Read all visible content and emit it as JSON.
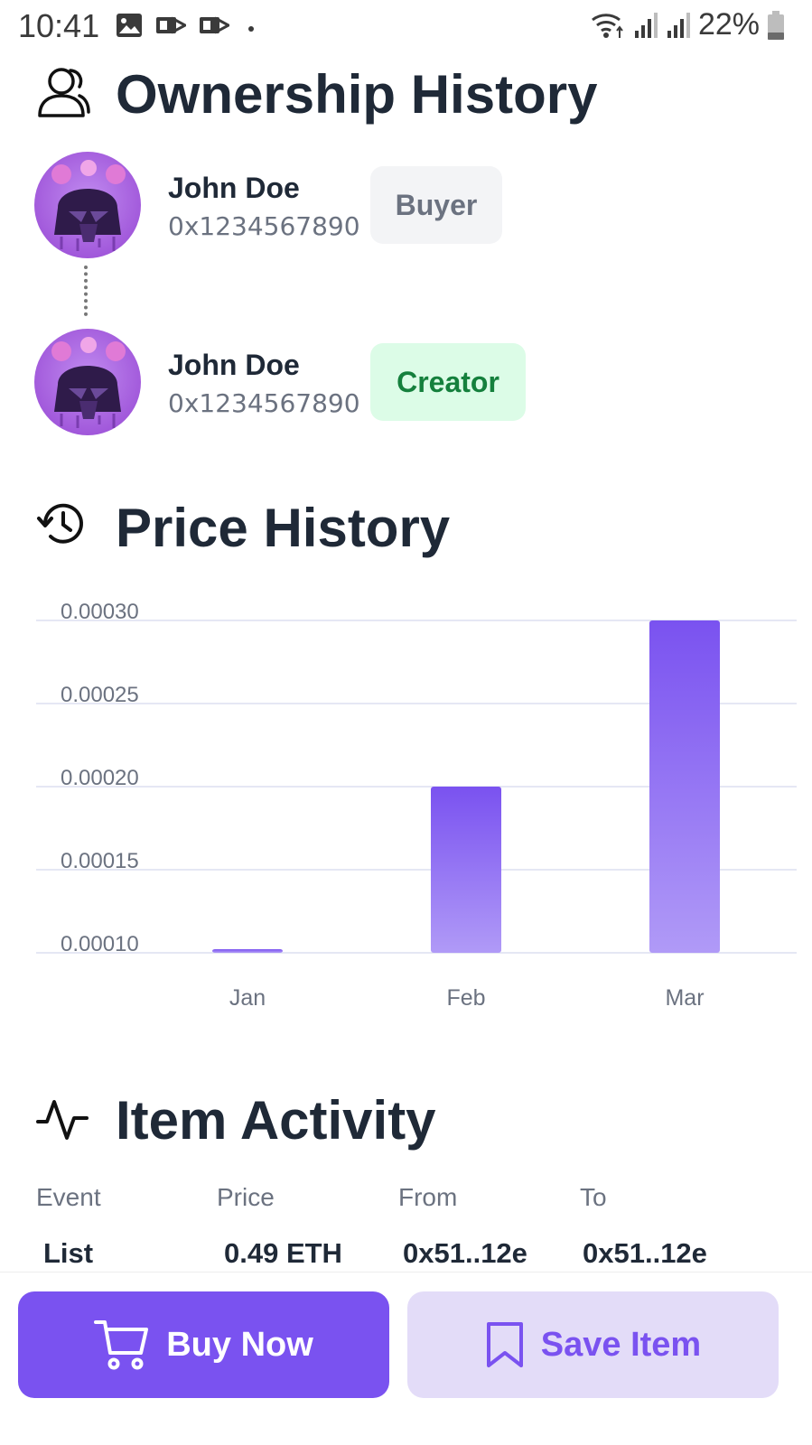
{
  "status_bar": {
    "time": "10:41",
    "battery": "22%",
    "icons_left": [
      "gallery-icon",
      "mail-icon",
      "mail-icon",
      "dot-icon"
    ],
    "icons_right": [
      "wifi-icon",
      "signal-icon",
      "signal-icon",
      "battery-icon"
    ]
  },
  "ownership": {
    "title": "Ownership History",
    "owners": [
      {
        "name": "John Doe",
        "address": "0x1234567890",
        "role": "Buyer"
      },
      {
        "name": "John Doe",
        "address": "0x1234567890",
        "role": "Creator"
      }
    ]
  },
  "price_history": {
    "title": "Price History"
  },
  "chart_data": {
    "type": "bar",
    "categories": [
      "Jan",
      "Feb",
      "Mar"
    ],
    "values": [
      0.0001,
      0.0002,
      0.0003
    ],
    "yticks": [
      "0.00010",
      "0.00015",
      "0.00020",
      "0.00025",
      "0.00030"
    ],
    "ylim": [
      0.0001,
      0.0003
    ],
    "grid": true,
    "color": "#8b66f3"
  },
  "activity": {
    "title": "Item Activity",
    "columns": [
      "Event",
      "Price",
      "From",
      "To"
    ],
    "rows": [
      [
        "List",
        "0.49 ETH",
        "0x51..12e",
        "0x51..12e"
      ]
    ]
  },
  "actions": {
    "buy_label": "Buy Now",
    "save_label": "Save Item"
  },
  "colors": {
    "accent": "#7a52f0",
    "accent_light": "#e3dcf8",
    "buyer_badge_bg": "#f3f4f6",
    "buyer_badge_text": "#6b7280",
    "creator_badge_bg": "#dcfce7",
    "creator_badge_text": "#15803d"
  }
}
